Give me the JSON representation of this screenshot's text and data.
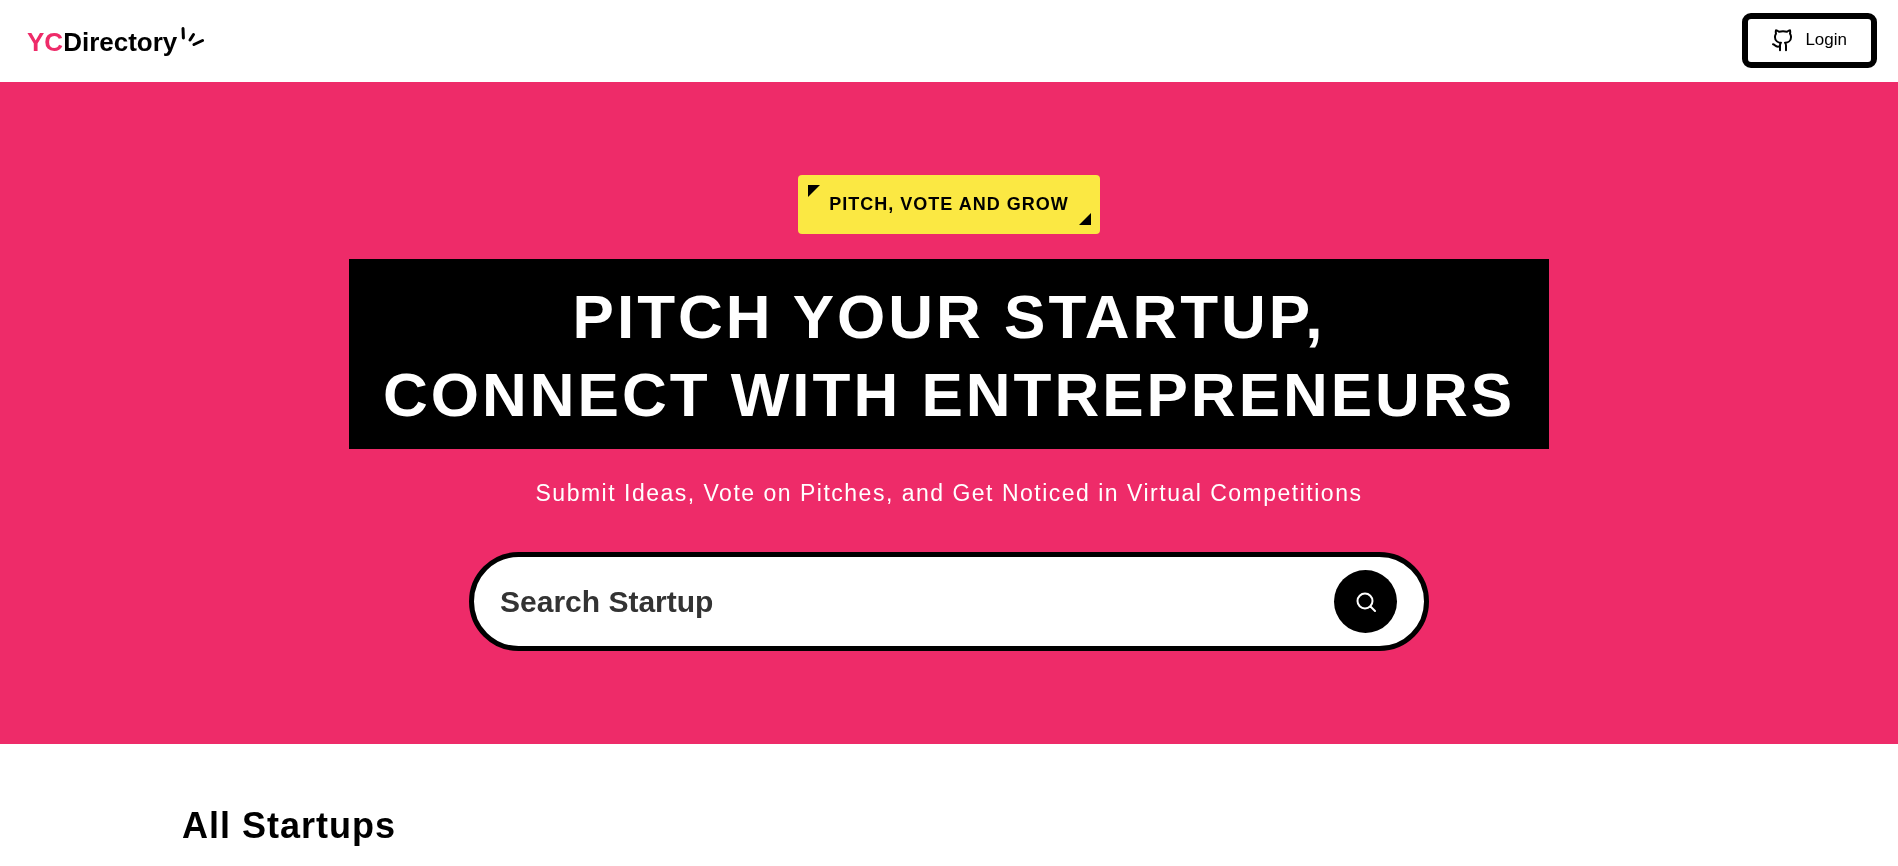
{
  "header": {
    "logo": {
      "accent": "YC",
      "text": "Directory"
    },
    "login_button": {
      "label": "Login"
    }
  },
  "hero": {
    "tag": "PITCH, VOTE AND GROW",
    "heading_lines": [
      "PITCH YOUR STARTUP,",
      "CONNECT WITH ENTREPRENEURS"
    ],
    "subheading": "Submit Ideas, Vote on Pitches, and Get Noticed in Virtual Competitions",
    "search": {
      "placeholder": "Search Startup"
    }
  },
  "startups_section": {
    "title": "All Startups"
  }
}
